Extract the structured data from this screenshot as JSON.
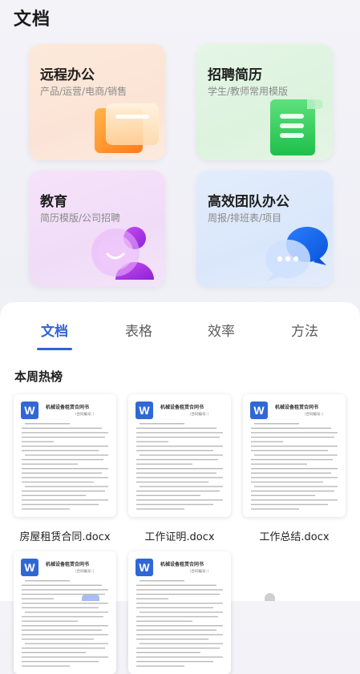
{
  "header": {
    "title": "文档"
  },
  "categories": [
    {
      "title": "远程办公",
      "subtitle": "产品/运营/电商/销售",
      "icon": "folder-icon"
    },
    {
      "title": "招聘简历",
      "subtitle": "学生/教师常用模版",
      "icon": "document-scroll-icon"
    },
    {
      "title": "教育",
      "subtitle": "简历模版/公司招聘",
      "icon": "person-icon"
    },
    {
      "title": "高效团队办公",
      "subtitle": "周报/排班表/项目",
      "icon": "chat-bubbles-icon"
    }
  ],
  "tabs": [
    {
      "label": "文档",
      "active": true
    },
    {
      "label": "表格",
      "active": false
    },
    {
      "label": "效率",
      "active": false
    },
    {
      "label": "方法",
      "active": false
    }
  ],
  "section": {
    "title": "本周热榜"
  },
  "documents": [
    {
      "name": "房屋租赁合同.docx",
      "preview_title": "机械设备租赁合同书",
      "preview_sub": "（合同编号：）",
      "badge": "W"
    },
    {
      "name": "工作证明.docx",
      "preview_title": "机械设备租赁合同书",
      "preview_sub": "（合同编号：）",
      "badge": "W"
    },
    {
      "name": "工作总结.docx",
      "preview_title": "机械设备租赁合同书",
      "preview_sub": "（合同编号：）",
      "badge": "W"
    },
    {
      "name": "",
      "preview_title": "机械设备租赁合同书",
      "preview_sub": "（合同编号：）",
      "badge": "W"
    },
    {
      "name": "",
      "preview_title": "机械设备租赁合同书",
      "preview_sub": "（合同编号：）",
      "badge": "W"
    }
  ],
  "colors": {
    "accent": "#2f62dc",
    "word_badge": "#2f68d6"
  }
}
